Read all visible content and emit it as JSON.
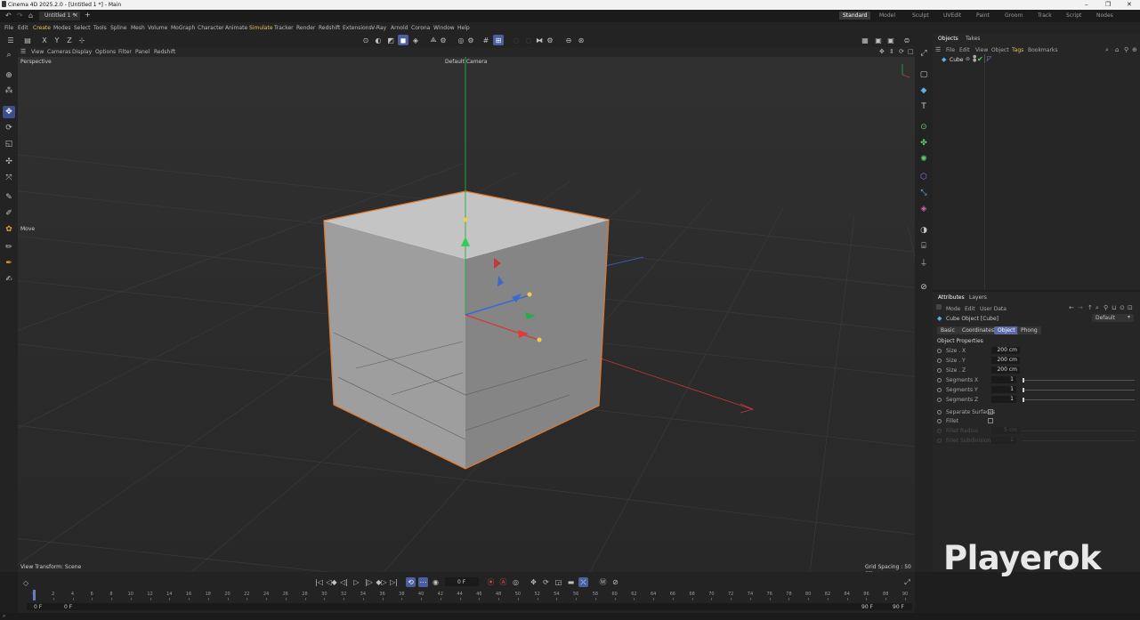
{
  "window": {
    "title": "Cinema 4D 2025.2.0 - [Untitled 1 *] - Main",
    "minimize": "–",
    "restore": "❐",
    "close": "✕"
  },
  "tabs": {
    "document": "Untitled 1 *",
    "close": "×",
    "add": "+"
  },
  "layouts": [
    "Standard",
    "Model",
    "Sculpt",
    "UVEdit",
    "Paint",
    "Groom",
    "Track",
    "Script",
    "Nodes"
  ],
  "menu": [
    "File",
    "Edit",
    "Create",
    "Modes",
    "Select",
    "Tools",
    "Spline",
    "Mesh",
    "Volume",
    "MoGraph",
    "Character",
    "Animate",
    "Simulate",
    "Tracker",
    "Render",
    "Redshift",
    "Extensions",
    "V-Ray",
    "Arnold",
    "Corona",
    "Window",
    "Help"
  ],
  "toolbar": {
    "axis_x": "X",
    "axis_y": "Y",
    "axis_z": "Z"
  },
  "viewport": {
    "menu": [
      "View",
      "Cameras",
      "Display",
      "Options",
      "Filter",
      "Panel",
      "Redshift"
    ],
    "name": "Perspective",
    "camera": "Default Camera",
    "tool_hint": "Move",
    "view_transform": "View Transform: Scene",
    "grid_spacing": "Grid Spacing : 50 cm"
  },
  "objects_panel": {
    "tabs": [
      "Objects",
      "Takes"
    ],
    "menu": [
      "File",
      "Edit",
      "View",
      "Object",
      "Tags",
      "Bookmarks"
    ],
    "items": [
      {
        "name": "Cube"
      }
    ]
  },
  "attributes_panel": {
    "tabs": [
      "Attributes",
      "Layers"
    ],
    "menu": [
      "Mode",
      "Edit",
      "User Data"
    ],
    "object_title": "Cube Object [Cube]",
    "preset": "Default",
    "subtabs": [
      "Basic",
      "Coordinates",
      "Object",
      "Phong"
    ],
    "section": "Object Properties",
    "size_x_label": "Size . X",
    "size_x": "200 cm",
    "size_y_label": "Size . Y",
    "size_y": "200 cm",
    "size_z_label": "Size . Z",
    "size_z": "200 cm",
    "seg_x_label": "Segments X",
    "seg_x": "1",
    "seg_y_label": "Segments Y",
    "seg_y": "1",
    "seg_z_label": "Segments Z",
    "seg_z": "1",
    "sep_surfaces": "Separate Surfaces",
    "fillet": "Fillet",
    "fillet_radius_label": "Fillet Radius",
    "fillet_radius": "5 cm",
    "fillet_subdiv_label": "Fillet Subdivision",
    "fillet_subdiv": "1"
  },
  "timeline": {
    "current_frame": "0 F",
    "start": "0 F",
    "start2": "0 F",
    "end": "90 F",
    "end2": "90 F",
    "ticks": [
      "0",
      "2",
      "4",
      "6",
      "8",
      "10",
      "12",
      "14",
      "16",
      "18",
      "20",
      "22",
      "24",
      "26",
      "28",
      "30",
      "32",
      "34",
      "36",
      "38",
      "40",
      "42",
      "44",
      "46",
      "48",
      "50",
      "52",
      "54",
      "56",
      "58",
      "60",
      "62",
      "64",
      "66",
      "68",
      "70",
      "72",
      "74",
      "76",
      "78",
      "80",
      "82",
      "84",
      "86",
      "88",
      "90"
    ]
  },
  "watermark": "Playerok",
  "colors": {
    "accent": "#4b5f9e",
    "selection_orange": "#e07a2a",
    "axis_x": "#d03a3a",
    "axis_y": "#3ad06a",
    "axis_z": "#3a6ad0",
    "menu_highlight": "#e8c15a"
  }
}
